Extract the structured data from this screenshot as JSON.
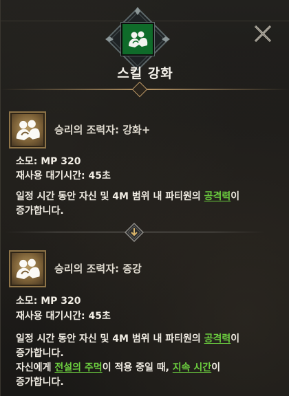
{
  "header": {
    "title": "스킬 강화",
    "icon_name": "allies-icon",
    "icon_color": "#0f6b2a"
  },
  "close_label": "close",
  "skills": [
    {
      "name": "승리의 조력자: 강화+",
      "icon_name": "allies-icon",
      "cost": "소모: MP 320",
      "cooldown": "재사용 대기시간: 45초",
      "desc1_pre": "일정 시간 동안 자신 및 4M 범위 내 파티원의 ",
      "desc1_link": "공격력",
      "desc1_post": "이",
      "desc2": "증가합니다."
    },
    {
      "name": "승리의 조력자: 증강",
      "icon_name": "allies-icon",
      "cost": "소모: MP 320",
      "cooldown": "재사용 대기시간: 45초",
      "desc1_pre": "일정 시간 동안 자신 및 4M 범위 내 파티원의 ",
      "desc1_link": "공격력",
      "desc1_post": "이",
      "desc2": "증가합니다.",
      "desc3_pre": "자신에게 ",
      "desc3_link1": "전설의 주먹",
      "desc3_mid": "이 적용 중일 때, ",
      "desc3_link2": "지속 시간",
      "desc3_post": "이",
      "desc4": "증가합니다."
    }
  ],
  "colors": {
    "highlight": "#6ccf3f",
    "accent_gold": "#b99664"
  }
}
